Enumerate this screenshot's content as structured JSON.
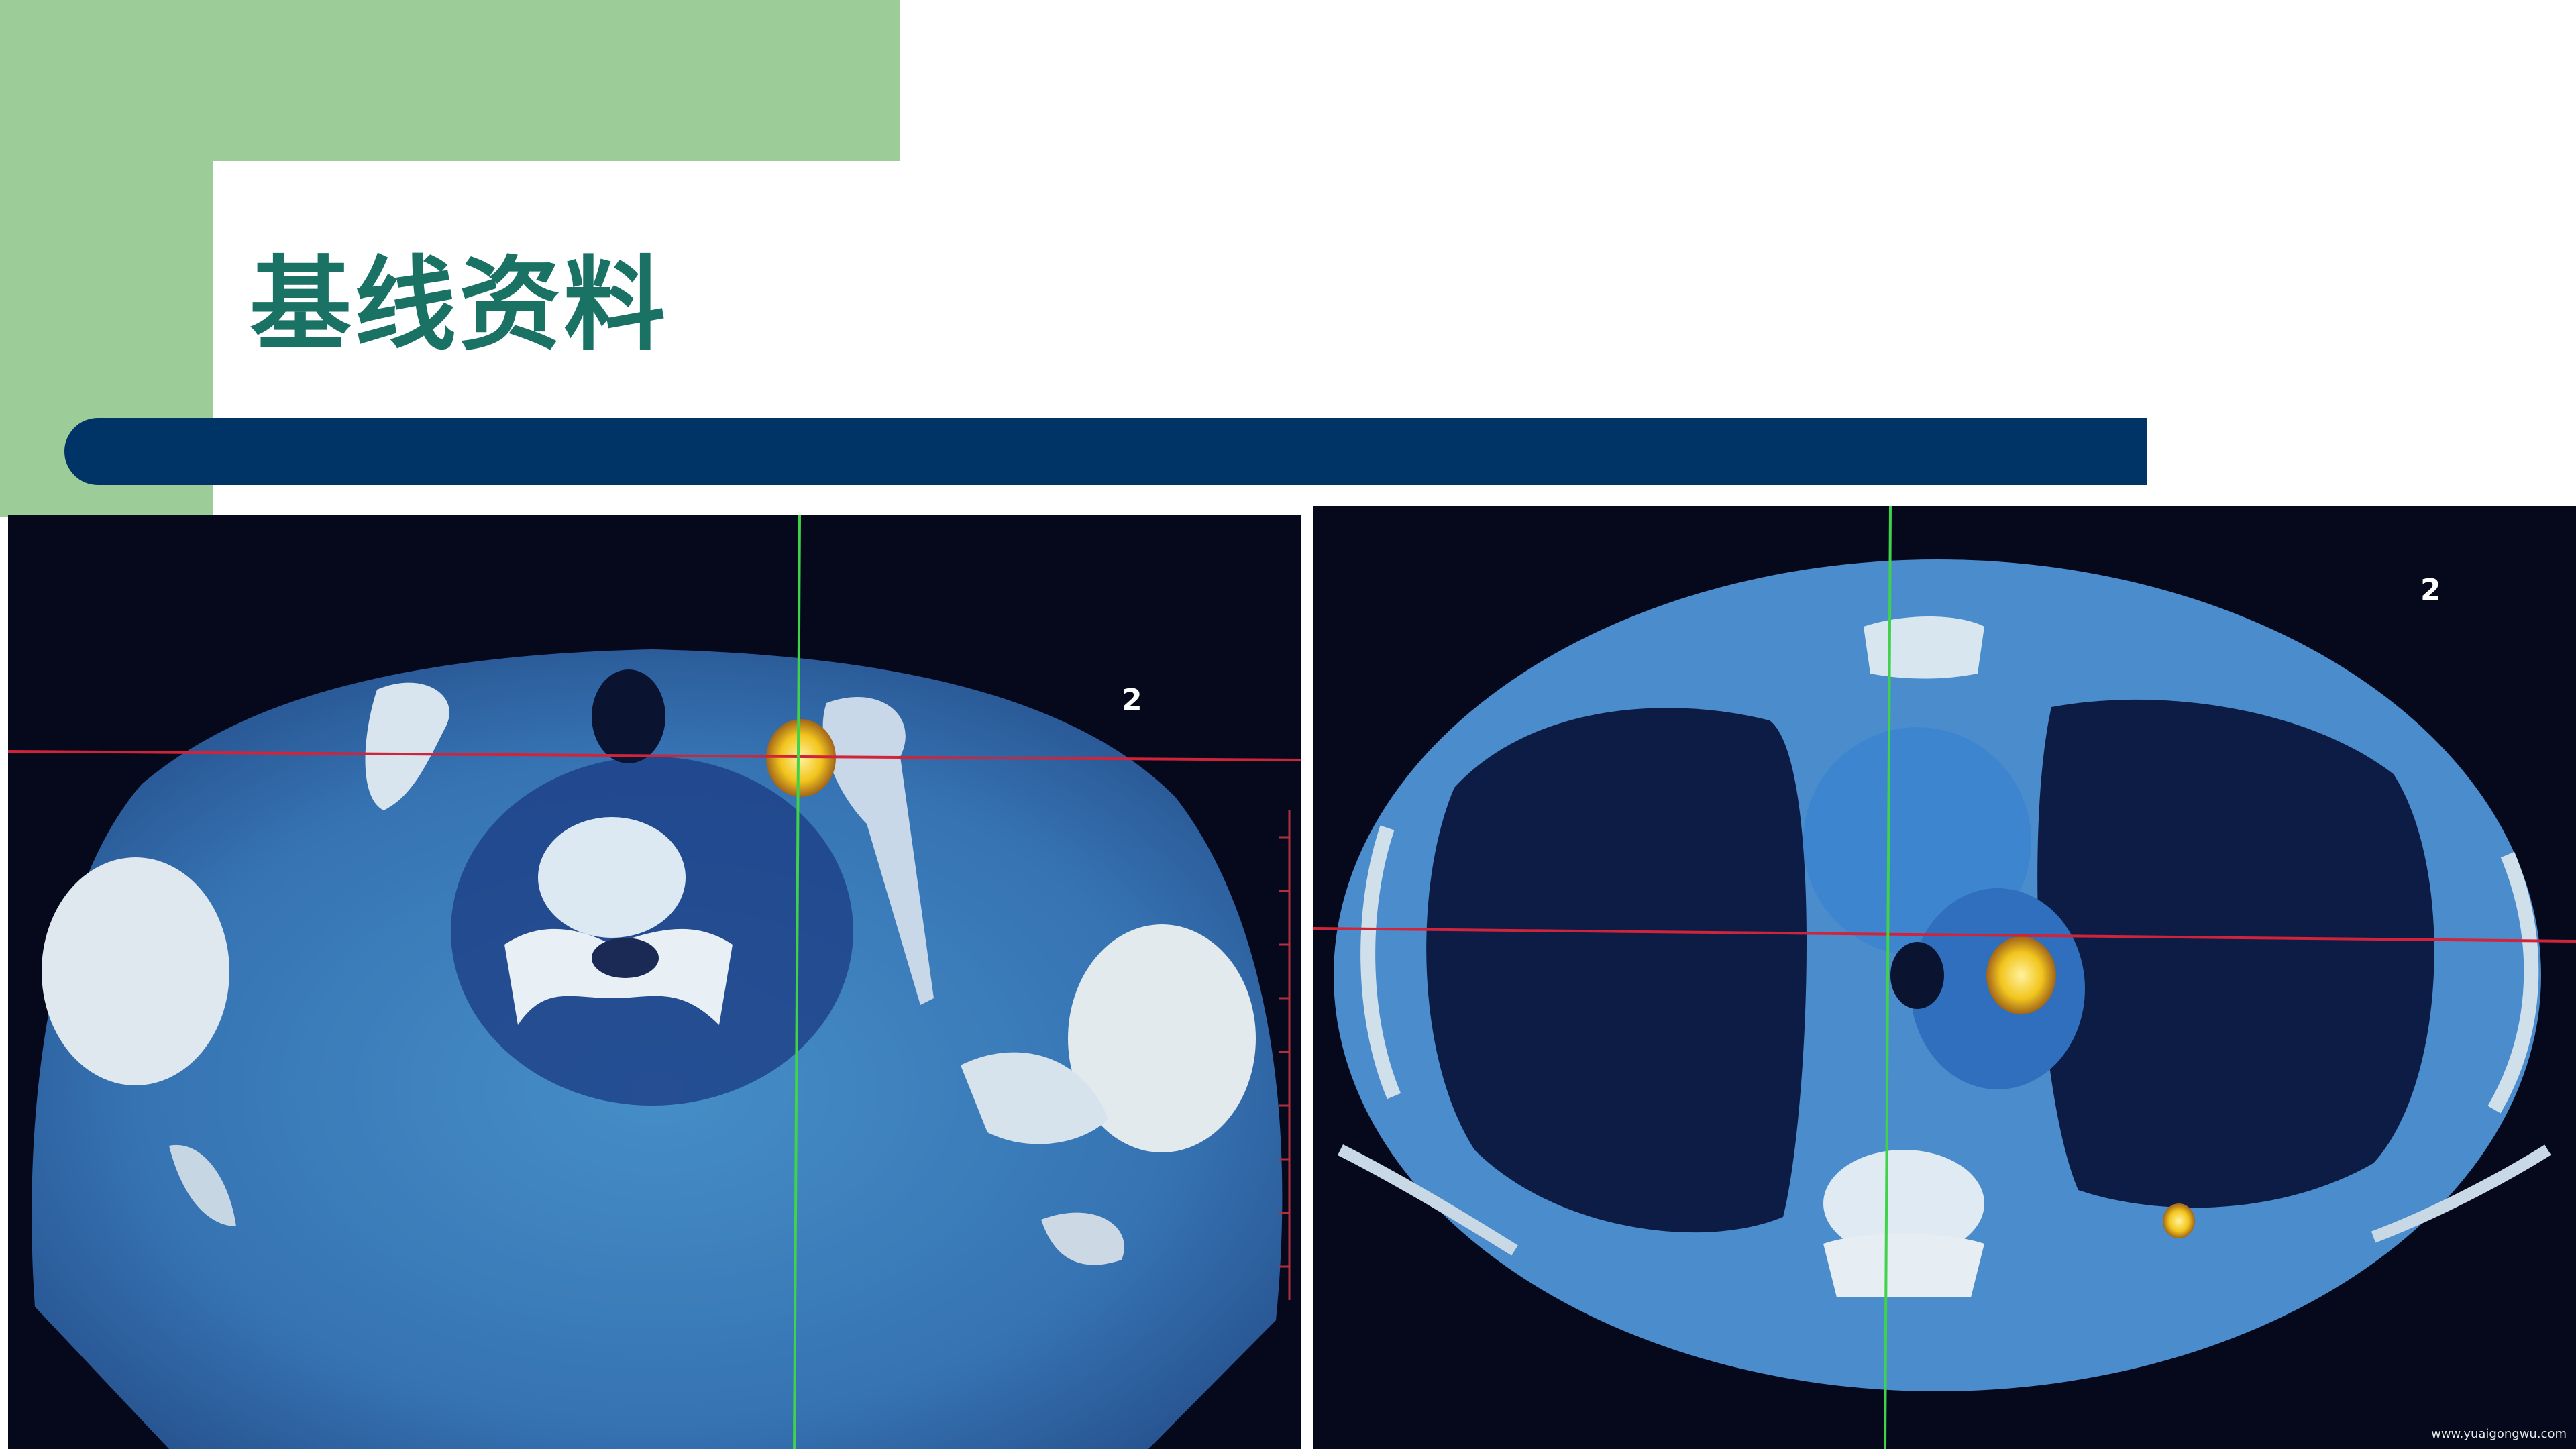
{
  "slide": {
    "title": "基线资料",
    "colors": {
      "accent_green": "#9ccd98",
      "title_text": "#1a7265",
      "title_bar": "#003366",
      "crosshair_red": "#d0243a",
      "crosshair_green": "#3fd24a",
      "uptake_hot": "#f2c51d"
    }
  },
  "images": {
    "left": {
      "slice_label": "2"
    },
    "right": {
      "slice_label": "2",
      "watermark": "www.yuaigongwu.com"
    }
  }
}
